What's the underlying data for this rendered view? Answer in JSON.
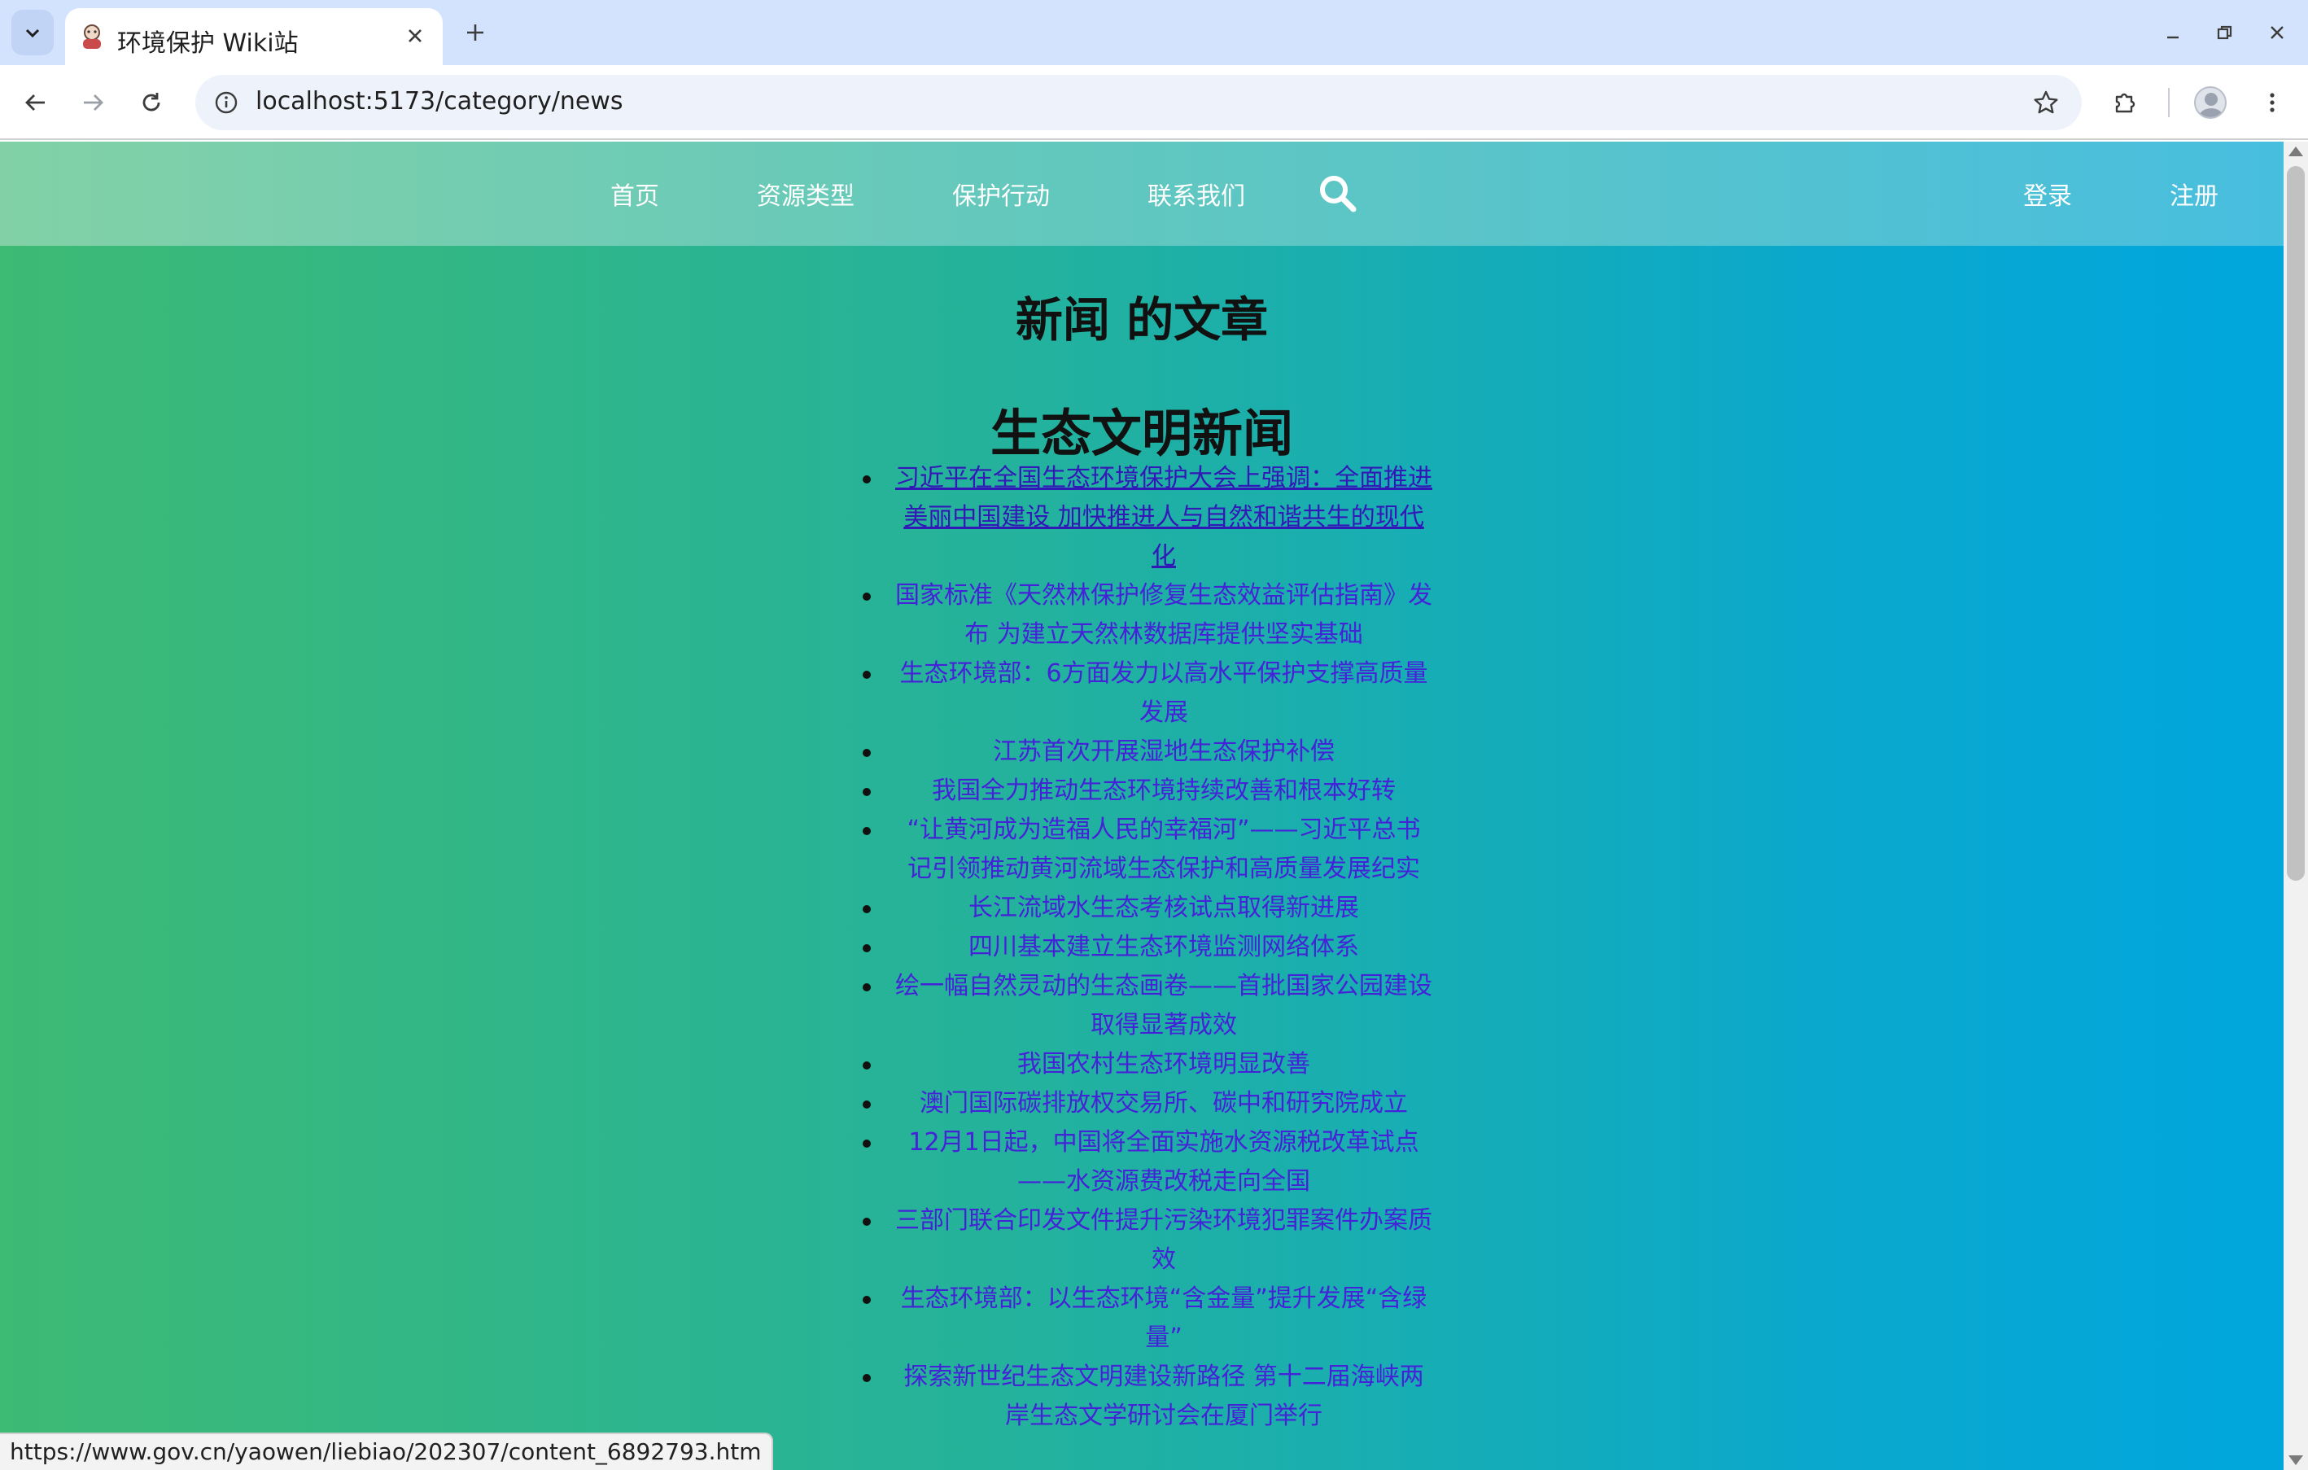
{
  "browser": {
    "tab_title": "环境保护 Wiki站",
    "url": "localhost:5173/category/news",
    "status_url": "https://www.gov.cn/yaowen/liebiao/202307/content_6892793.htm"
  },
  "nav": {
    "home": "首页",
    "resource_types": "资源类型",
    "protection_actions": "保护行动",
    "contact_us": "联系我们",
    "login": "登录",
    "register": "注册"
  },
  "page": {
    "heading": "新闻 的文章",
    "section_title": "生态文明新闻"
  },
  "articles": [
    "习近平在全国生态环境保护大会上强调：全面推进美丽中国建设 加快推进人与自然和谐共生的现代化",
    "国家标准《天然林保护修复生态效益评估指南》发布 为建立天然林数据库提供坚实基础",
    "生态环境部：6方面发力以高水平保护支撑高质量发展",
    "江苏首次开展湿地生态保护补偿",
    "我国全力推动生态环境持续改善和根本好转",
    "“让黄河成为造福人民的幸福河”——习近平总书记引领推动黄河流域生态保护和高质量发展纪实",
    "长江流域水生态考核试点取得新进展",
    "四川基本建立生态环境监测网络体系",
    "绘一幅自然灵动的生态画卷——首批国家公园建设取得显著成效",
    "我国农村生态环境明显改善",
    "澳门国际碳排放权交易所、碳中和研究院成立",
    "12月1日起，中国将全面实施水资源税改革试点——水资源费改税走向全国",
    "三部门联合印发文件提升污染环境犯罪案件办案质效",
    "生态环境部：以生态环境“含金量”提升发展“含绿量”",
    "探索新世纪生态文明建设新路径 第十二届海峡两岸生态文学研讨会在厦门举行"
  ],
  "colors": {
    "link": "#4422d8",
    "header_gradient": [
      "#82d1a6",
      "#48bedf"
    ],
    "page_gradient": [
      "#3dba74",
      "#00a6dd"
    ]
  }
}
